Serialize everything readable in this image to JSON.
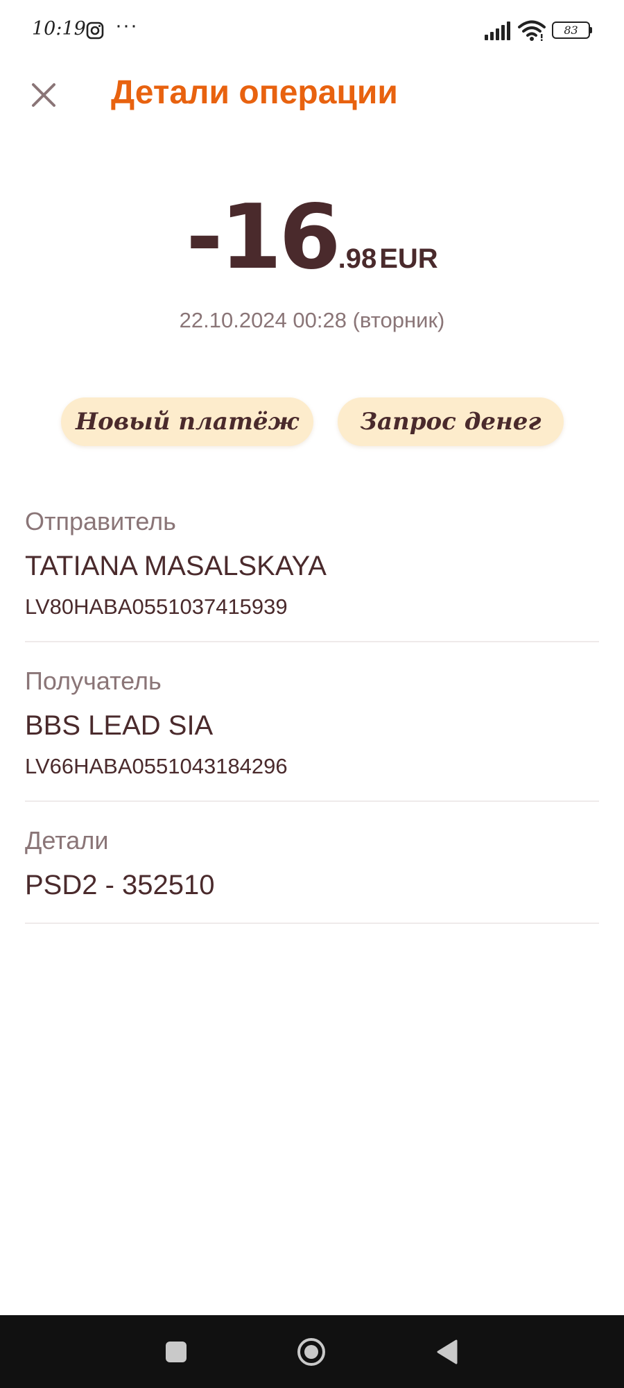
{
  "status_bar": {
    "time": "10:19",
    "dots": "···",
    "battery": "83",
    "icons": [
      "instagram-icon",
      "signal-icon",
      "wifi-icon",
      "battery-icon"
    ]
  },
  "header": {
    "title": "Детали операции",
    "close_icon": "close-icon"
  },
  "transaction": {
    "amount_major": "-16",
    "amount_minor": ".98",
    "currency": "EUR",
    "datetime": "22.10.2024 00:28 (вторник)"
  },
  "actions": {
    "new_payment": "Новый платёж",
    "request_money": "Запрос денег"
  },
  "sender": {
    "label": "Отправитель",
    "name": "TATIANA MASALSKAYA",
    "iban": "LV80HABA0551037415939"
  },
  "receiver": {
    "label": "Получатель",
    "name": "BBS LEAD SIA",
    "iban": "LV66HABA0551043184296"
  },
  "details": {
    "label": "Детали",
    "value": "PSD2 - 352510"
  },
  "nav": {
    "icons": [
      "recents-icon",
      "home-icon",
      "back-icon"
    ]
  },
  "colors": {
    "accent": "#e8620f",
    "text_primary": "#4a2a2c",
    "text_secondary": "#8a7577",
    "pill_background": "#fdeccc",
    "nav_background": "#111111"
  }
}
